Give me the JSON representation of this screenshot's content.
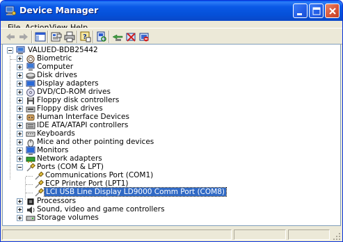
{
  "window": {
    "title": "Device Manager",
    "title_icon": "computer-management-icon"
  },
  "menu": {
    "items": [
      {
        "label": "File",
        "accel": "F",
        "rest": "ile"
      },
      {
        "label": "Action",
        "accel": "A",
        "rest": "ction"
      },
      {
        "label": "View",
        "accel": "V",
        "rest": "iew"
      },
      {
        "label": "Help",
        "accel": "H",
        "rest": "elp"
      }
    ]
  },
  "toolbar": {
    "buttons": [
      "back-arrow-icon",
      "forward-arrow-icon",
      "show-hide-console-tree-icon",
      "properties-icon",
      "print-icon",
      "help-icon",
      "scan-hardware-icon",
      "update-driver-icon",
      "uninstall-icon",
      "disable-icon"
    ]
  },
  "tree": {
    "root": "VALUED-BDB25442",
    "categories": [
      {
        "label": "Biometric",
        "icon": "biometric-icon"
      },
      {
        "label": "Computer",
        "icon": "computer-icon"
      },
      {
        "label": "Disk drives",
        "icon": "disk-drive-icon"
      },
      {
        "label": "Display adapters",
        "icon": "display-adapter-icon"
      },
      {
        "label": "DVD/CD-ROM drives",
        "icon": "dvd-drive-icon"
      },
      {
        "label": "Floppy disk controllers",
        "icon": "floppy-controller-icon"
      },
      {
        "label": "Floppy disk drives",
        "icon": "floppy-drive-icon"
      },
      {
        "label": "Human Interface Devices",
        "icon": "hid-icon"
      },
      {
        "label": "IDE ATA/ATAPI controllers",
        "icon": "ide-controller-icon"
      },
      {
        "label": "Keyboards",
        "icon": "keyboard-icon"
      },
      {
        "label": "Mice and other pointing devices",
        "icon": "mouse-icon"
      },
      {
        "label": "Monitors",
        "icon": "monitor-icon"
      },
      {
        "label": "Network adapters",
        "icon": "network-adapter-icon"
      },
      {
        "label": "Ports (COM & LPT)",
        "icon": "port-icon",
        "expanded": true
      },
      {
        "label": "Processors",
        "icon": "processor-icon"
      },
      {
        "label": "Sound, video and game controllers",
        "icon": "sound-icon"
      },
      {
        "label": "Storage volumes",
        "icon": "storage-volume-icon"
      }
    ],
    "ports_children": [
      {
        "label": "Communications Port (COM1)",
        "icon": "port-icon"
      },
      {
        "label": "ECP Printer Port (LPT1)",
        "icon": "port-icon"
      },
      {
        "label": "LCI USB Line Display LD9000 Comm Port (COM8)",
        "icon": "port-icon",
        "selected": true
      }
    ]
  },
  "colors": {
    "title_bar": "#0550d8",
    "selection": "#316ac5",
    "window_bg": "#ece9d8"
  }
}
